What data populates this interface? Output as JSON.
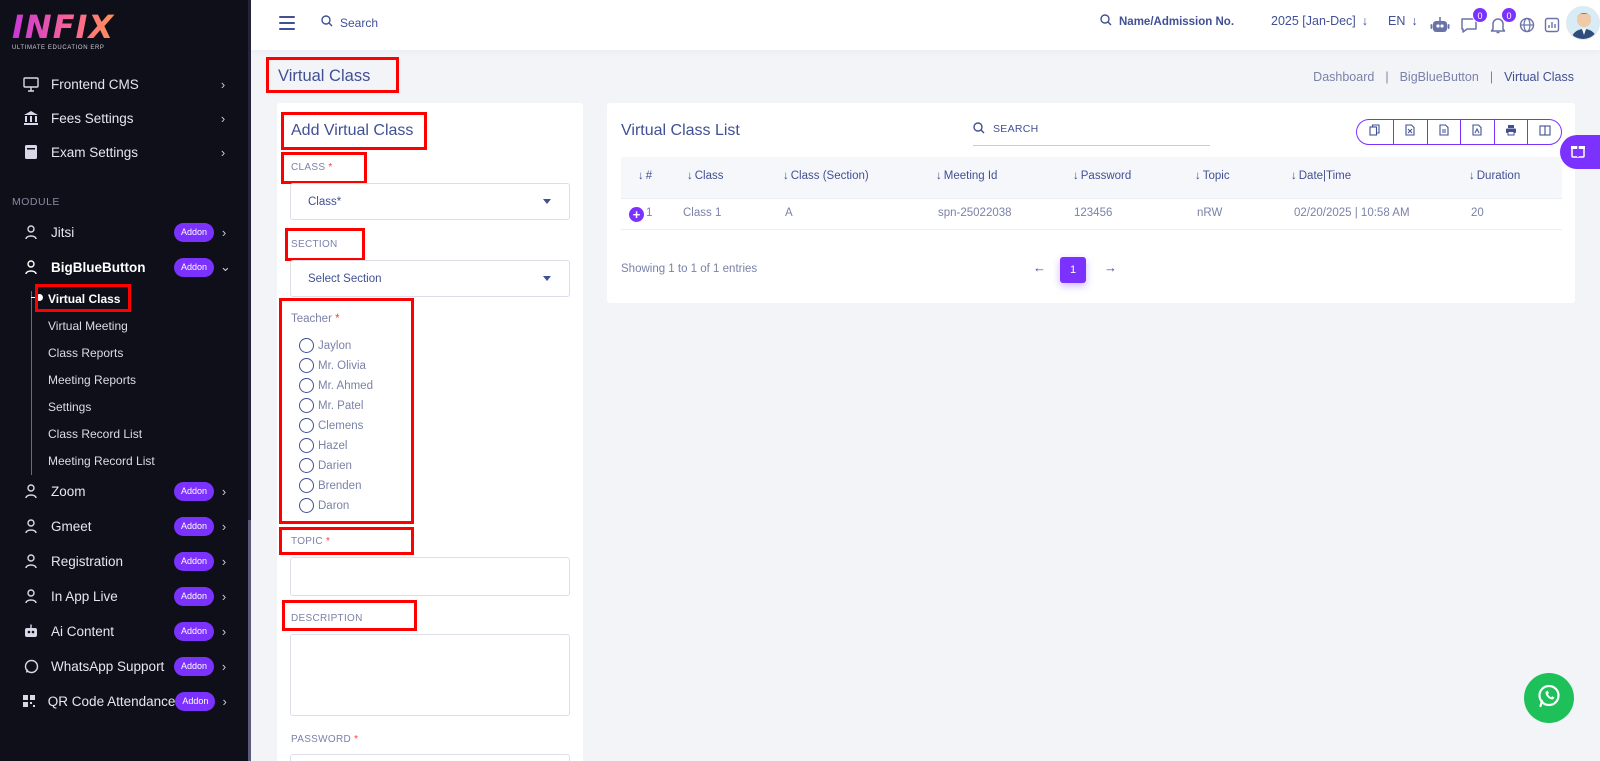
{
  "logo": {
    "text": "INFIX",
    "subtitle": "ULTIMATE EDUCATION ERP"
  },
  "sidebar": {
    "top_items": [
      {
        "label": "Frontend CMS",
        "icon": "monitor-icon"
      },
      {
        "label": "Fees Settings",
        "icon": "bank-icon"
      },
      {
        "label": "Exam Settings",
        "icon": "book-icon"
      }
    ],
    "module_label": "MODULE",
    "modules": [
      {
        "label": "Jitsi",
        "badge": "Addon",
        "icon": "user-icon"
      },
      {
        "label": "BigBlueButton",
        "badge": "Addon",
        "icon": "user-icon"
      },
      {
        "label": "Zoom",
        "badge": "Addon",
        "icon": "user-icon"
      },
      {
        "label": "Gmeet",
        "badge": "Addon",
        "icon": "user-icon"
      },
      {
        "label": "Registration",
        "badge": "Addon",
        "icon": "user-icon"
      },
      {
        "label": "In App Live",
        "badge": "Addon",
        "icon": "user-icon"
      },
      {
        "label": "Ai Content",
        "badge": "Addon",
        "icon": "robot-icon"
      },
      {
        "label": "WhatsApp Support",
        "badge": "Addon",
        "icon": "whatsapp-icon"
      },
      {
        "label": "QR Code Attendance",
        "badge": "Addon",
        "icon": "qr-code-icon"
      }
    ],
    "submenu": [
      "Virtual Class",
      "Virtual Meeting",
      "Class Reports",
      "Meeting Reports",
      "Settings",
      "Class Record List",
      "Meeting Record List"
    ]
  },
  "topbar": {
    "search_label": "Search",
    "student_search_label": "Name/Admission No.",
    "session": "2025 [Jan-Dec]",
    "language": "EN",
    "chat_count": "0",
    "notification_count": "0"
  },
  "page": {
    "title": "Virtual Class",
    "breadcrumb": [
      "Dashboard",
      "BigBlueButton",
      "Virtual Class"
    ]
  },
  "form": {
    "title": "Add Virtual Class",
    "class_label": "CLASS",
    "class_placeholder": "Class*",
    "section_label": "SECTION",
    "section_placeholder": "Select Section",
    "teacher_label": "Teacher",
    "teachers": [
      "Jaylon",
      "Mr. Olivia",
      "Mr. Ahmed",
      "Mr. Patel",
      "Clemens",
      "Hazel",
      "Darien",
      "Brenden",
      "Daron"
    ],
    "topic_label": "TOPIC",
    "description_label": "DESCRIPTION",
    "password_label": "PASSWORD",
    "required_mark": "*"
  },
  "list": {
    "title": "Virtual Class List",
    "search_placeholder": "SEARCH",
    "columns": [
      "#",
      "Class",
      "Class (Section)",
      "Meeting Id",
      "Password",
      "Topic",
      "Date|Time",
      "Duration"
    ],
    "rows": [
      {
        "index": "1",
        "class": "Class 1",
        "section": "A",
        "meeting_id": "spn-25022038",
        "password": "123456",
        "topic": "nRW",
        "datetime": "02/20/2025 | 10:58 AM",
        "duration": "20"
      }
    ],
    "showing": "Showing 1 to 1 of 1 entries",
    "current_page": "1"
  },
  "colors": {
    "accent": "#7c32ff",
    "text": "#415094",
    "sidebar_bg": "#0f0f1a",
    "annotation": "#ff0000"
  }
}
